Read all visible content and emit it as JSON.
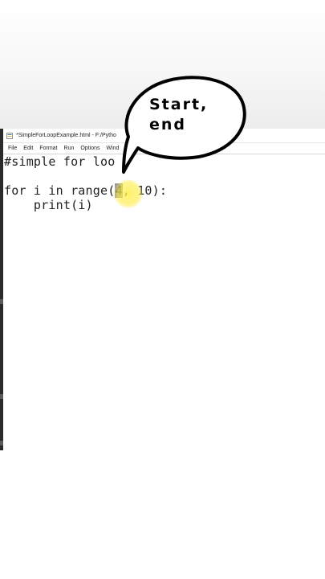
{
  "window": {
    "title": "*SimpleForLoopExample.html - F:/Pytho"
  },
  "menu": {
    "items": [
      "File",
      "Edit",
      "Format",
      "Run",
      "Options",
      "Wind"
    ]
  },
  "code": {
    "line1": "#simple for loo",
    "line3_prefix": "for i in range(",
    "line3_selected": "4",
    "line3_suffix": ", 10):",
    "line4": "    print(i)"
  },
  "annotation": {
    "line1": "Start,",
    "line2": "end"
  },
  "icons": {
    "app": "python-file-icon"
  }
}
